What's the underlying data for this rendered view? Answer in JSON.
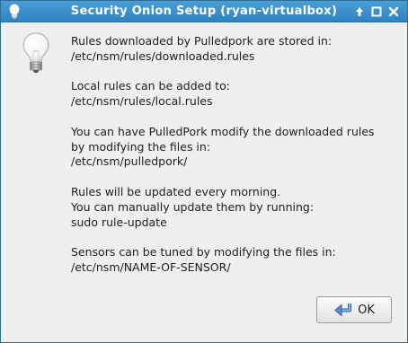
{
  "window": {
    "title": "Security Onion Setup (ryan-virtualbox)",
    "controls": [
      "shade",
      "maximize",
      "close"
    ]
  },
  "message": {
    "paragraphs": [
      [
        "Rules downloaded by Pulledpork are stored in:",
        "/etc/nsm/rules/downloaded.rules"
      ],
      [
        "Local rules can be added to:",
        "/etc/nsm/rules/local.rules"
      ],
      [
        "You can have PulledPork modify the downloaded rules",
        "by modifying the files in:",
        "/etc/nsm/pulledpork/"
      ],
      [
        "Rules will be updated every morning.",
        "You can manually update them by running:",
        "sudo rule-update"
      ],
      [
        "Sensors can be tuned by modifying the files in:",
        "/etc/nsm/NAME-OF-SENSOR/"
      ]
    ]
  },
  "buttons": {
    "ok_label": "OK"
  },
  "icons": {
    "window_icon": "lightbulb-icon",
    "dialog_icon": "lightbulb-icon",
    "ok_icon": "return-arrow-icon"
  },
  "colors": {
    "titlebar": "#3a90cc",
    "background": "#efefef",
    "text": "#1e1e1e"
  }
}
